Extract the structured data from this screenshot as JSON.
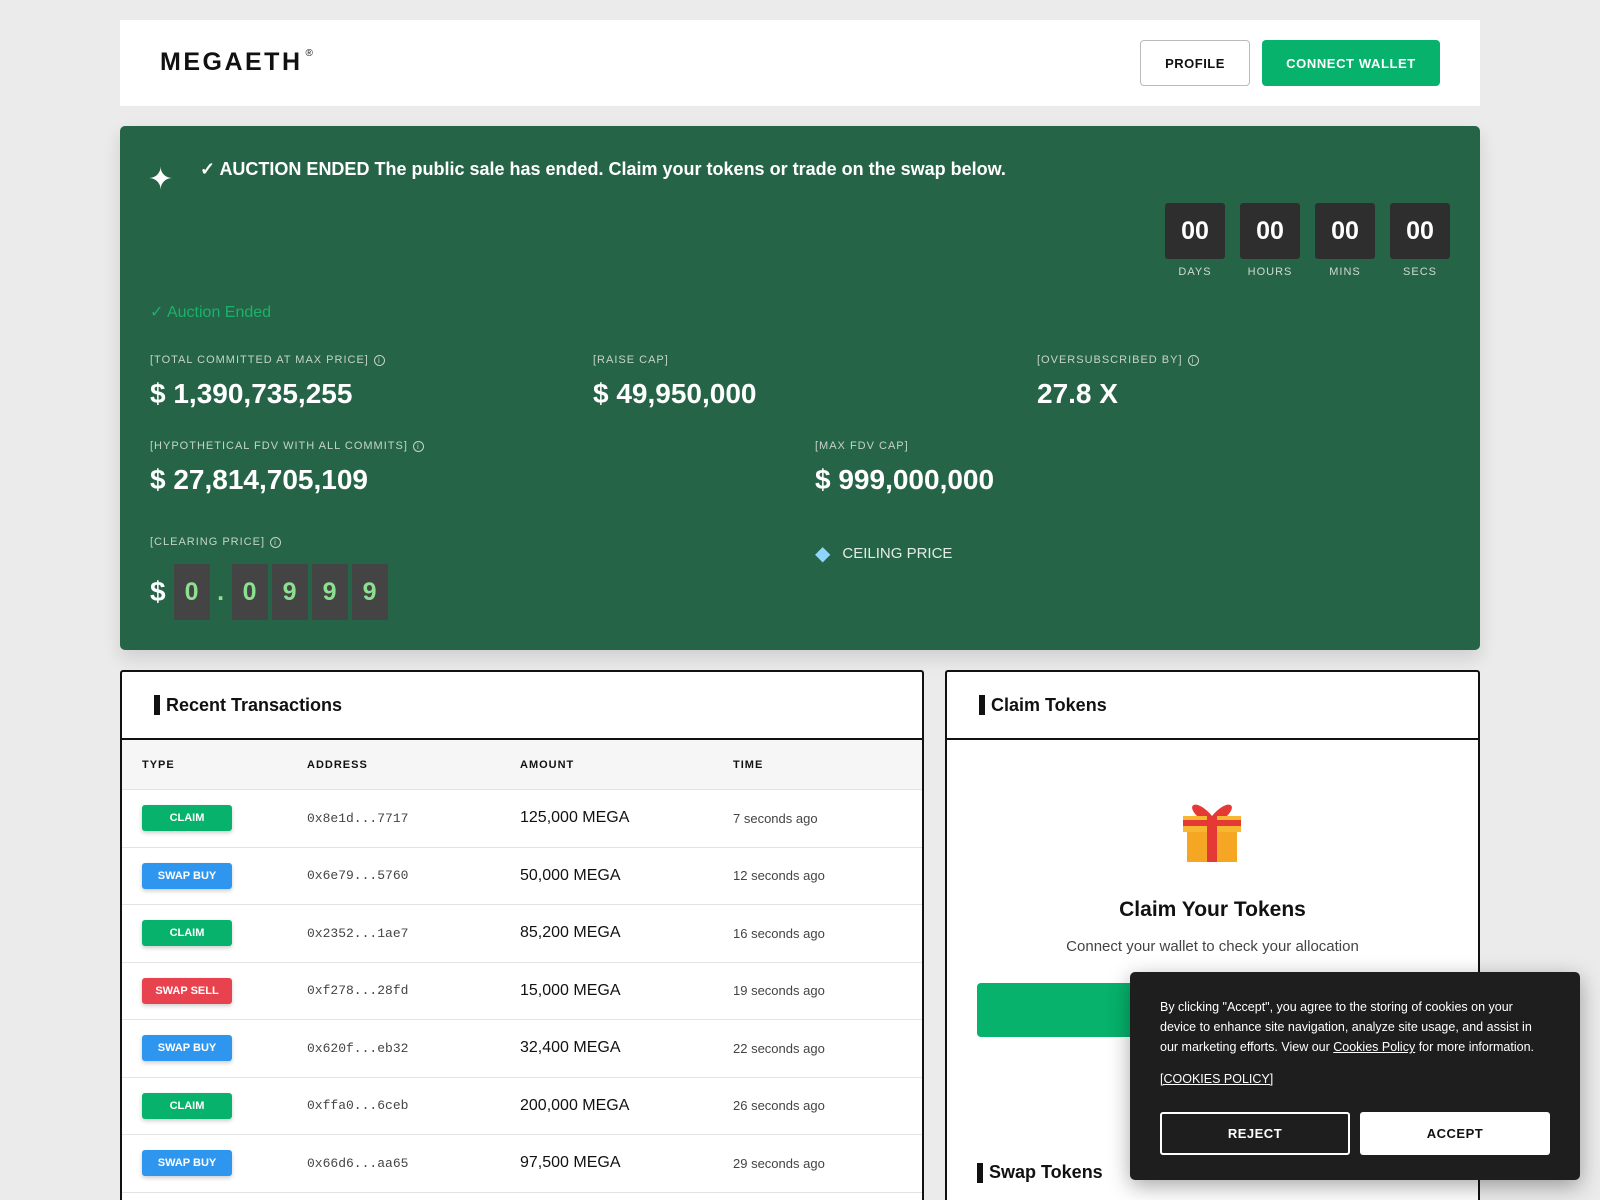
{
  "header": {
    "logo": "MEGAETH",
    "logo_mark": "®",
    "profile_label": "PROFILE",
    "connect_label": "CONNECT WALLET"
  },
  "hero": {
    "banner_check": "✓",
    "banner_strong": "AUCTION ENDED",
    "banner_text": "The public sale has ended. Claim your tokens or trade on the swap below.",
    "countdown": [
      {
        "value": "00",
        "label": "DAYS"
      },
      {
        "value": "00",
        "label": "HOURS"
      },
      {
        "value": "00",
        "label": "MINS"
      },
      {
        "value": "00",
        "label": "SECS"
      }
    ],
    "status": "✓ Auction Ended",
    "stats": {
      "total_committed": {
        "label": "[TOTAL COMMITTED AT MAX PRICE]",
        "value": "$ 1,390,735,255"
      },
      "raise_cap": {
        "label": "[RAISE CAP]",
        "value": "$ 49,950,000"
      },
      "oversubscribed": {
        "label": "[OVERSUBSCRIBED BY]",
        "value": "27.8 X"
      },
      "hypothetical_fdv": {
        "label": "[HYPOTHETICAL FDV WITH ALL COMMITS]",
        "value": "$ 27,814,705,109"
      },
      "max_fdv": {
        "label": "[MAX FDV CAP]",
        "value": "$ 999,000,000"
      }
    },
    "clearing": {
      "label": "[CLEARING PRICE]",
      "currency": "$",
      "digits": [
        "0",
        ".",
        "0",
        "9",
        "9",
        "9"
      ]
    },
    "ceiling_label": "CEILING PRICE",
    "info_glyph": "i"
  },
  "transactions": {
    "title": "Recent Transactions",
    "columns": [
      "TYPE",
      "ADDRESS",
      "AMOUNT",
      "TIME"
    ],
    "rows": [
      {
        "type": "CLAIM",
        "color": "#06b26c",
        "address": "0x8e1d...7717",
        "amount": "125,000 MEGA",
        "time": "7 seconds ago"
      },
      {
        "type": "SWAP BUY",
        "color": "#2f96f0",
        "address": "0x6e79...5760",
        "amount": "50,000 MEGA",
        "time": "12 seconds ago"
      },
      {
        "type": "CLAIM",
        "color": "#06b26c",
        "address": "0x2352...1ae7",
        "amount": "85,200 MEGA",
        "time": "16 seconds ago"
      },
      {
        "type": "SWAP SELL",
        "color": "#e8424f",
        "address": "0xf278...28fd",
        "amount": "15,000 MEGA",
        "time": "19 seconds ago"
      },
      {
        "type": "SWAP BUY",
        "color": "#2f96f0",
        "address": "0x620f...eb32",
        "amount": "32,400 MEGA",
        "time": "22 seconds ago"
      },
      {
        "type": "CLAIM",
        "color": "#06b26c",
        "address": "0xffa0...6ceb",
        "amount": "200,000 MEGA",
        "time": "26 seconds ago"
      },
      {
        "type": "SWAP BUY",
        "color": "#2f96f0",
        "address": "0x66d6...aa65",
        "amount": "97,500 MEGA",
        "time": "29 seconds ago"
      }
    ]
  },
  "claim": {
    "title": "Claim Tokens",
    "heading": "Claim Your Tokens",
    "subtext": "Connect your wallet to check your allocation",
    "swap_title": "Swap Tokens"
  },
  "cookie": {
    "text_before": "By clicking \"Accept\", you agree to the storing of cookies on your device to enhance site navigation, analyze site usage, and assist in our marketing efforts. View our ",
    "link": "Cookies Policy",
    "text_after": " for more information.",
    "policy_link": "[COOKIES POLICY]",
    "reject": "REJECT",
    "accept": "ACCEPT"
  }
}
